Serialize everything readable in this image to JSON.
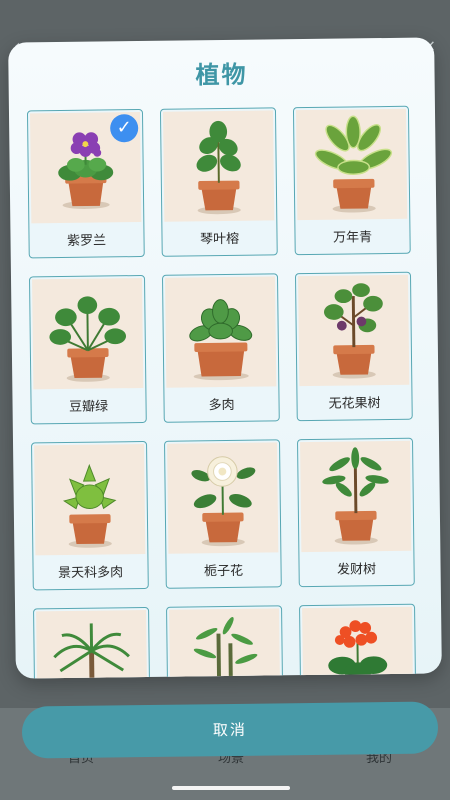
{
  "modal": {
    "title": "植物",
    "plants": [
      {
        "label": "紫罗兰",
        "icon": "african-violet-plant-icon",
        "selected": true
      },
      {
        "label": "琴叶榕",
        "icon": "fiddle-leaf-fig-plant-icon",
        "selected": false
      },
      {
        "label": "万年青",
        "icon": "dieffenbachia-plant-icon",
        "selected": false
      },
      {
        "label": "豆瓣绿",
        "icon": "peperomia-plant-icon",
        "selected": false
      },
      {
        "label": "多肉",
        "icon": "succulent-plant-icon",
        "selected": false
      },
      {
        "label": "无花果树",
        "icon": "fig-tree-plant-icon",
        "selected": false
      },
      {
        "label": "景天科多肉",
        "icon": "crassula-succulent-plant-icon",
        "selected": false
      },
      {
        "label": "栀子花",
        "icon": "gardenia-plant-icon",
        "selected": false
      },
      {
        "label": "发财树",
        "icon": "money-tree-plant-icon",
        "selected": false
      },
      {
        "label": "",
        "icon": "palm-plant-icon",
        "selected": false
      },
      {
        "label": "",
        "icon": "bamboo-plant-icon",
        "selected": false
      },
      {
        "label": "",
        "icon": "kalanchoe-plant-icon",
        "selected": false
      }
    ]
  },
  "cancel_label": "取消",
  "tabbar": {
    "items": [
      "首页",
      "场景",
      "我的"
    ]
  },
  "colors": {
    "accent": "#479aa8",
    "title": "#3f96a6",
    "check": "#3d8ff0",
    "card_border": "#57a7b3",
    "pot": "#c8693c"
  }
}
